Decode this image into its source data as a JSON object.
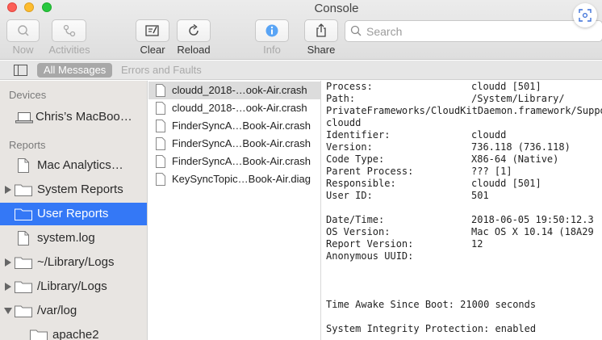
{
  "window": {
    "title": "Console"
  },
  "toolbar": {
    "now_label": "Now",
    "activities_label": "Activities",
    "clear_label": "Clear",
    "reload_label": "Reload",
    "info_label": "Info",
    "share_label": "Share",
    "search_placeholder": "Search"
  },
  "filterbar": {
    "all_messages": "All Messages",
    "errors_and_faults": "Errors and Faults"
  },
  "sidebar": {
    "devices_header": "Devices",
    "device_name": "Chris’s MacBoo…",
    "reports_header": "Reports",
    "items": [
      {
        "label": "Mac Analytics…",
        "icon": "document-icon",
        "disclosure": false
      },
      {
        "label": "System Reports",
        "icon": "folder-icon",
        "disclosure": true
      },
      {
        "label": "User Reports",
        "icon": "folder-icon",
        "disclosure": false,
        "selected": true
      },
      {
        "label": "system.log",
        "icon": "document-icon",
        "disclosure": false
      },
      {
        "label": "~/Library/Logs",
        "icon": "folder-icon",
        "disclosure": true
      },
      {
        "label": "/Library/Logs",
        "icon": "folder-icon",
        "disclosure": true
      },
      {
        "label": "/var/log",
        "icon": "folder-icon",
        "disclosure": true,
        "expanded": true
      },
      {
        "label": "apache2",
        "icon": "folder-icon",
        "disclosure": false
      }
    ]
  },
  "files": [
    {
      "label": "cloudd_2018-…ook-Air.crash",
      "selected": true
    },
    {
      "label": "cloudd_2018-…ook-Air.crash"
    },
    {
      "label": "FinderSyncA…Book-Air.crash"
    },
    {
      "label": "FinderSyncA…Book-Air.crash"
    },
    {
      "label": "FinderSyncA…Book-Air.crash"
    },
    {
      "label": "KeySyncTopic…Book-Air.diag"
    }
  ],
  "report": {
    "process_label": "Process:",
    "process_value": "cloudd [501]",
    "path_label": "Path:",
    "path_value": "/System/Library/",
    "path_cont": "PrivateFrameworks/CloudKitDaemon.framework/Support/",
    "path_cont2": "cloudd",
    "identifier_label": "Identifier:",
    "identifier_value": "cloudd",
    "version_label": "Version:",
    "version_value": "736.118 (736.118)",
    "code_type_label": "Code Type:",
    "code_type_value": "X86-64 (Native)",
    "parent_label": "Parent Process:",
    "parent_value": "??? [1]",
    "responsible_label": "Responsible:",
    "responsible_value": "cloudd [501]",
    "user_id_label": "User ID:",
    "user_id_value": "501",
    "datetime_label": "Date/Time:",
    "datetime_value": "2018-06-05 19:50:12.3",
    "os_label": "OS Version:",
    "os_value": "Mac OS X 10.14 (18A29",
    "report_version_label": "Report Version:",
    "report_version_value": "12",
    "uuid_label": "Anonymous UUID:",
    "time_awake": "Time Awake Since Boot: 21000 seconds",
    "sip": "System Integrity Protection: enabled"
  },
  "colors": {
    "selection": "#3478f6",
    "sidebar_bg": "#e8e5e2"
  }
}
